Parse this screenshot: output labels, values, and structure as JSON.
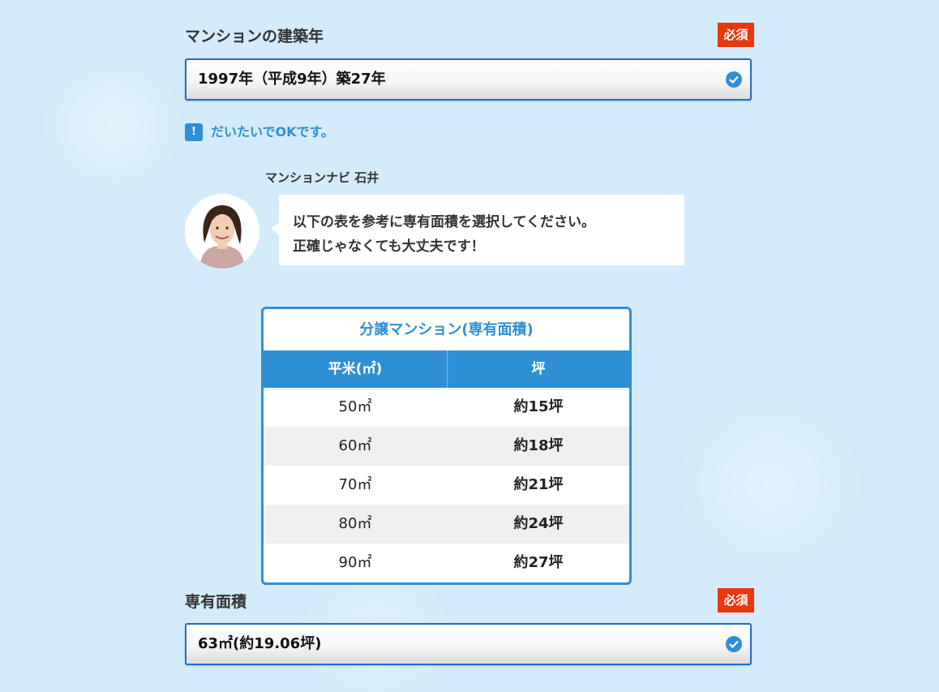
{
  "build_year": {
    "label": "マンションの建築年",
    "required_badge": "必須",
    "selected": "1997年（平成9年）築27年"
  },
  "hint": {
    "icon": "!",
    "text": "だいたいでOKです。"
  },
  "advisor": {
    "name": "マンションナビ 石井",
    "message_line1": "以下の表を参考に専有面積を選択してください。",
    "message_line2": "正確じゃなくても大丈夫です！"
  },
  "area_table": {
    "title": "分譲マンション(専有面積)",
    "headers": [
      "平米(㎡)",
      "坪"
    ],
    "rows": [
      [
        "50㎡",
        "約15坪"
      ],
      [
        "60㎡",
        "約18坪"
      ],
      [
        "70㎡",
        "約21坪"
      ],
      [
        "80㎡",
        "約24坪"
      ],
      [
        "90㎡",
        "約27坪"
      ]
    ]
  },
  "floor_area": {
    "label": "専有面積",
    "required_badge": "必須",
    "selected": "63㎡(約19.06坪)"
  },
  "colors": {
    "accent": "#2f8fd5",
    "required": "#e8380d",
    "background": "#d3ebfb"
  }
}
